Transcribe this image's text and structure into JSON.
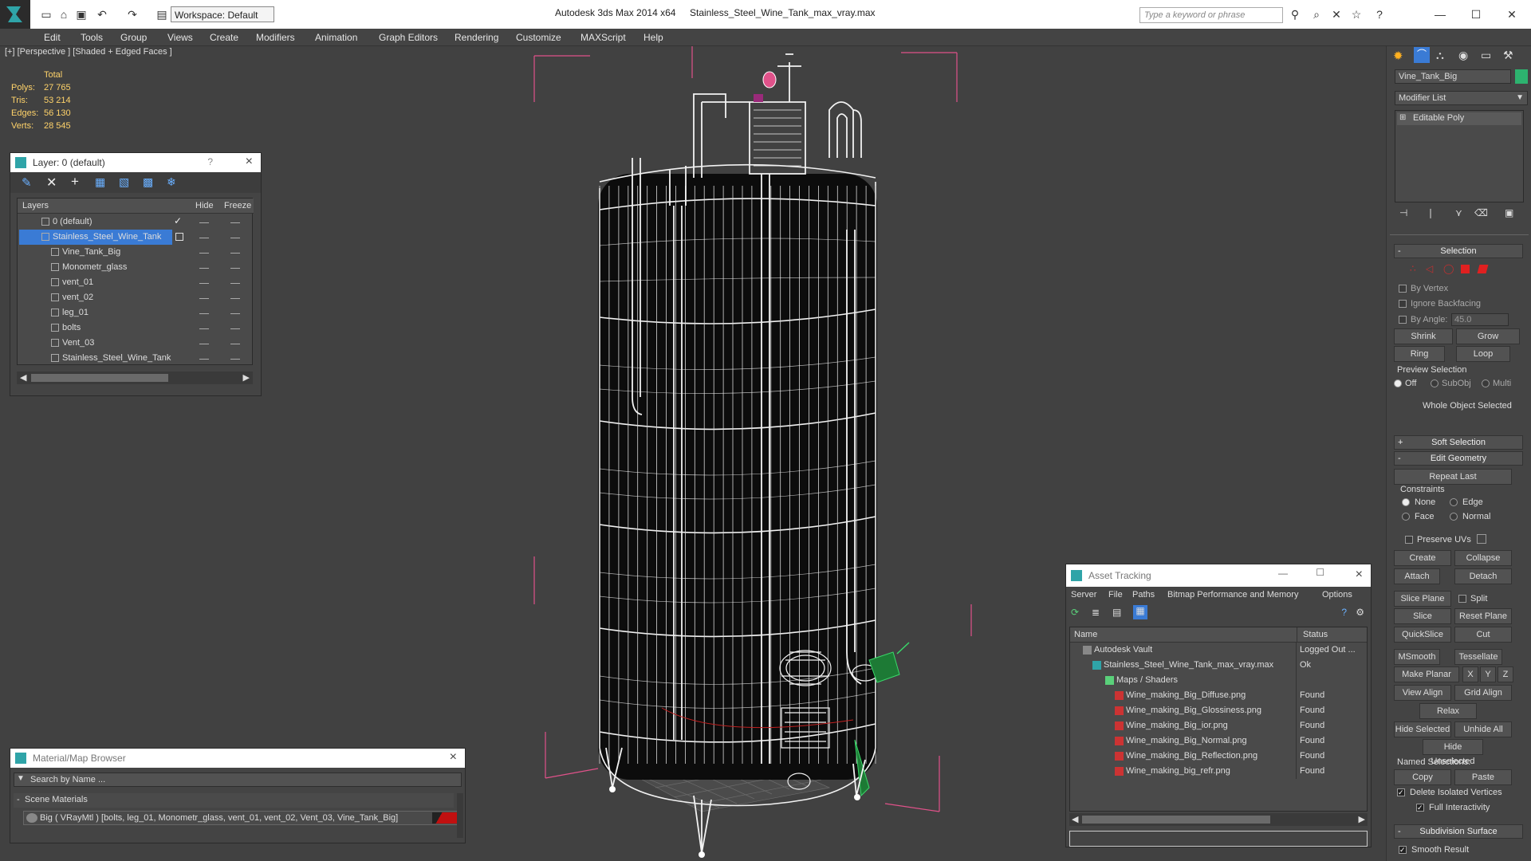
{
  "titlebar": {
    "workspace": "Workspace: Default",
    "app": "Autodesk 3ds Max  2014 x64",
    "file": "Stainless_Steel_Wine_Tank_max_vray.max",
    "search_placeholder": "Type a keyword or phrase"
  },
  "menu": [
    "Edit",
    "Tools",
    "Group",
    "Views",
    "Create",
    "Modifiers",
    "Animation",
    "Graph Editors",
    "Rendering",
    "Customize",
    "MAXScript",
    "Help"
  ],
  "viewport": {
    "label": "[+] [Perspective ] [Shaded + Edged Faces ]",
    "stats": {
      "header": "Total",
      "polys_label": "Polys:",
      "polys": "27 765",
      "tris_label": "Tris:",
      "tris": "53 214",
      "edges_label": "Edges:",
      "edges": "56 130",
      "verts_label": "Verts:",
      "verts": "28 545"
    }
  },
  "layer_panel": {
    "title": "Layer: 0 (default)",
    "help": "?",
    "col_layers": "Layers",
    "col_hide": "Hide",
    "col_freeze": "Freeze",
    "rows": [
      "0 (default)",
      "Stainless_Steel_Wine_Tank",
      "Vine_Tank_Big",
      "Monometr_glass",
      "vent_01",
      "vent_02",
      "leg_01",
      "bolts",
      "Vent_03",
      "Stainless_Steel_Wine_Tank"
    ]
  },
  "material_browser": {
    "title": "Material/Map Browser",
    "search": "Search by Name ...",
    "section": "Scene Materials",
    "item": "Big  ( VRayMtl ) [bolts, leg_01, Monometr_glass, vent_01, vent_02, Vent_03, Vine_Tank_Big]"
  },
  "asset_tracking": {
    "title": "Asset Tracking",
    "menu": [
      "Server",
      "File",
      "Paths",
      "Bitmap Performance and Memory",
      "Options"
    ],
    "col_name": "Name",
    "col_status": "Status",
    "rows": [
      {
        "name": "Autodesk Vault",
        "status": "Logged Out ..."
      },
      {
        "name": "Stainless_Steel_Wine_Tank_max_vray.max",
        "status": "Ok"
      },
      {
        "name": "Maps / Shaders",
        "status": ""
      },
      {
        "name": "Wine_making_Big_Diffuse.png",
        "status": "Found"
      },
      {
        "name": "Wine_making_Big_Glossiness.png",
        "status": "Found"
      },
      {
        "name": "Wine_making_Big_ior.png",
        "status": "Found"
      },
      {
        "name": "Wine_making_Big_Normal.png",
        "status": "Found"
      },
      {
        "name": "Wine_making_Big_Reflection.png",
        "status": "Found"
      },
      {
        "name": "Wine_making_big_refr.png",
        "status": "Found"
      }
    ]
  },
  "command_panel": {
    "object_name": "Vine_Tank_Big",
    "modifier_list": "Modifier List",
    "stack_item": "Editable Poly",
    "selection": {
      "header": "Selection",
      "by_vertex": "By Vertex",
      "ignore_backfacing": "Ignore Backfacing",
      "by_angle": "By Angle:",
      "angle_value": "45.0",
      "shrink": "Shrink",
      "grow": "Grow",
      "ring": "Ring",
      "loop": "Loop",
      "preview": "Preview Selection",
      "off": "Off",
      "subobj": "SubObj",
      "multi": "Multi",
      "status": "Whole Object Selected"
    },
    "soft_selection": "Soft Selection",
    "edit_geometry": {
      "header": "Edit Geometry",
      "repeat_last": "Repeat Last",
      "constraints": "Constraints",
      "none": "None",
      "edge": "Edge",
      "face": "Face",
      "normal": "Normal",
      "preserve_uvs": "Preserve UVs",
      "create": "Create",
      "collapse": "Collapse",
      "attach": "Attach",
      "detach": "Detach",
      "slice_plane": "Slice Plane",
      "split": "Split",
      "slice": "Slice",
      "reset_plane": "Reset Plane",
      "quickslice": "QuickSlice",
      "cut": "Cut",
      "msmooth": "MSmooth",
      "tessellate": "Tessellate",
      "make_planar": "Make Planar",
      "x": "X",
      "y": "Y",
      "z": "Z",
      "view_align": "View Align",
      "grid_align": "Grid Align",
      "relax": "Relax",
      "hide_selected": "Hide Selected",
      "unhide_all": "Unhide All",
      "hide_unselected": "Hide Unselected",
      "named_selections": "Named Selections:",
      "copy": "Copy",
      "paste": "Paste",
      "delete_isolated": "Delete Isolated Vertices",
      "full_interactivity": "Full Interactivity"
    },
    "subdivision": {
      "header": "Subdivision Surface",
      "smooth_result": "Smooth Result"
    }
  },
  "colors": {
    "accent": "#3a7bd5",
    "selection_red": "#e02020",
    "object_color": "#2db36f"
  }
}
